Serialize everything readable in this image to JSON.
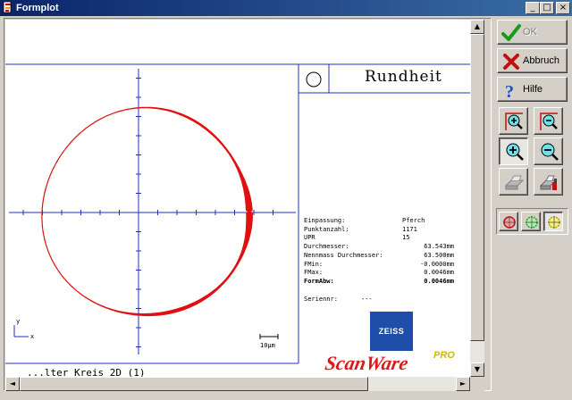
{
  "window": {
    "title": "Formplot"
  },
  "buttons": {
    "ok": "OK",
    "cancel": "Abbruch",
    "help": "Hilfe"
  },
  "result": {
    "title": "Rundheit",
    "rows": [
      {
        "label": "Einpassung:",
        "value": "Pferch",
        "bold": false
      },
      {
        "label": "Punktanzahl:",
        "value": "1171",
        "bold": false
      },
      {
        "label": "UPR",
        "value": "15",
        "bold": false
      },
      {
        "label": "Durchmesser:",
        "value": "63.543mm",
        "bold": false
      },
      {
        "label": "Nennmass Durchmesser:",
        "value": "63.500mm",
        "bold": false
      },
      {
        "label": "FMin:",
        "value": "-0.0000mm",
        "bold": false
      },
      {
        "label": "FMax:",
        "value": "0.0046mm",
        "bold": false
      },
      {
        "label": "FormAbw:",
        "value": "0.0046mm",
        "bold": true
      }
    ],
    "serial_label": "Seriennr:",
    "serial_value": "---"
  },
  "plot": {
    "scale_label": "10µm",
    "axis_y": "y",
    "axis_x": "x",
    "bottom_text": "...lter Kreis 2D (1)"
  },
  "branding": {
    "zeiss": "ZEISS",
    "product": "ScanWare",
    "edition": "PRO"
  },
  "colors": {
    "profile": "#e01010",
    "axes": "#2030c0",
    "accent": "#0a246a"
  }
}
